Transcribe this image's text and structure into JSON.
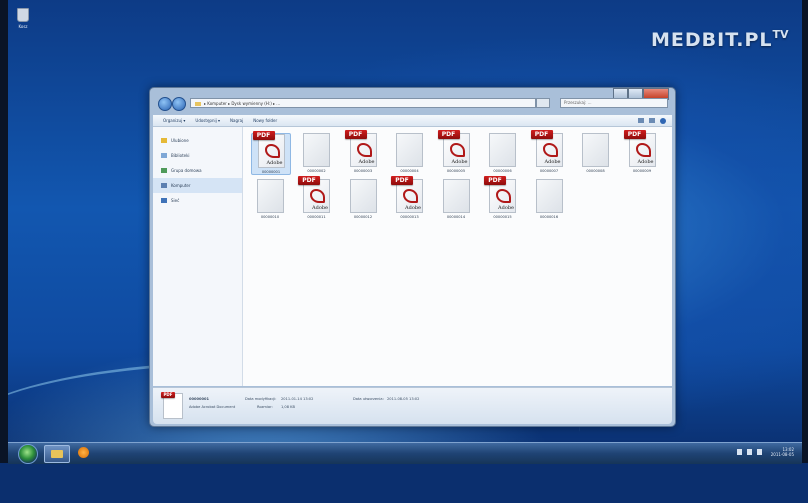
{
  "watermark": {
    "text": "MEDBIT.PL",
    "sup": "TV"
  },
  "desktop": {
    "recycle_bin_label": "Kosz"
  },
  "window": {
    "address_path": "▸ Komputer ▸ Dysk wymienny (H:) ▸ ...",
    "search_placeholder": "Przeszukaj: ...",
    "toolbar": [
      "Organizuj ▾",
      "Udostępnij ▾",
      "Nagraj",
      "Nowy folder"
    ],
    "nav_items": [
      {
        "label": "Ulubione",
        "color": "#e5b937"
      },
      {
        "label": "Biblioteki",
        "color": "#7ea7d6"
      },
      {
        "label": "Grupa domowa",
        "color": "#4f9a5a"
      },
      {
        "label": "Komputer",
        "color": "#5b7fb0",
        "selected": true
      },
      {
        "label": "Sieć",
        "color": "#3f73b8"
      }
    ],
    "files_row1": [
      {
        "name": "00000001",
        "type": "pdf",
        "selected": true
      },
      {
        "name": "00000002",
        "type": "blank"
      },
      {
        "name": "00000003",
        "type": "pdf"
      },
      {
        "name": "00000004",
        "type": "blank"
      },
      {
        "name": "00000005",
        "type": "pdf"
      },
      {
        "name": "00000006",
        "type": "blank"
      },
      {
        "name": "00000007",
        "type": "pdf"
      },
      {
        "name": "00000008",
        "type": "blank"
      },
      {
        "name": "00000009",
        "type": "pdf"
      }
    ],
    "files_row2": [
      {
        "name": "00000010",
        "type": "blank"
      },
      {
        "name": "00000011",
        "type": "pdf"
      },
      {
        "name": "00000012",
        "type": "blank"
      },
      {
        "name": "00000013",
        "type": "pdf"
      },
      {
        "name": "00000014",
        "type": "blank"
      },
      {
        "name": "00000015",
        "type": "pdf"
      },
      {
        "name": "00000016",
        "type": "blank"
      }
    ],
    "pdf_tag": "PDF",
    "adobe_label": "Adobe",
    "details": {
      "filename": "00000001",
      "filetype": "Adobe Acrobat Document",
      "modified_label": "Data modyfikacji:",
      "modified_value": "2011-01-14 13:02",
      "size_label": "Rozmiar:",
      "size_value": "1,08 KB",
      "created_label": "Data utworzenia:",
      "created_value": "2011-08-05 13:02"
    }
  },
  "taskbar": {
    "time": "13:02",
    "date": "2011-08-05"
  }
}
